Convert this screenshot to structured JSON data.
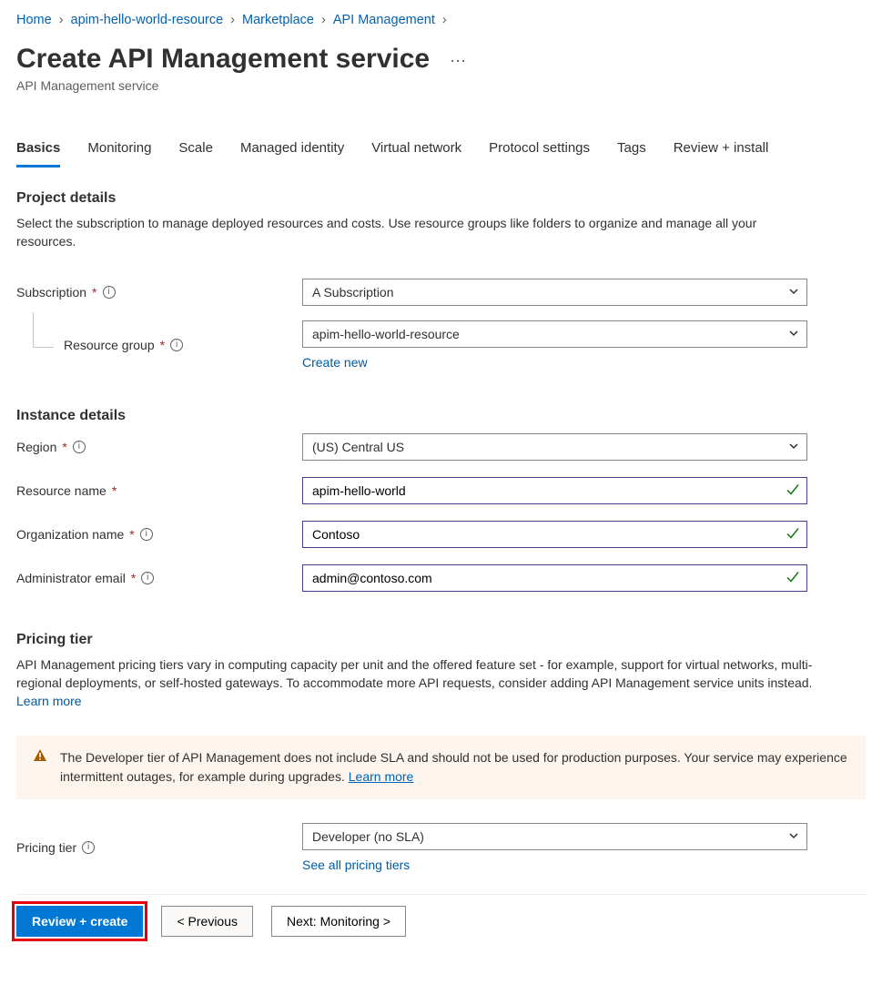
{
  "breadcrumb": {
    "items": [
      {
        "label": "Home"
      },
      {
        "label": "apim-hello-world-resource"
      },
      {
        "label": "Marketplace"
      },
      {
        "label": "API Management"
      }
    ]
  },
  "header": {
    "title": "Create API Management service",
    "subtitle": "API Management service"
  },
  "tabs": [
    {
      "label": "Basics",
      "active": true
    },
    {
      "label": "Monitoring"
    },
    {
      "label": "Scale"
    },
    {
      "label": "Managed identity"
    },
    {
      "label": "Virtual network"
    },
    {
      "label": "Protocol settings"
    },
    {
      "label": "Tags"
    },
    {
      "label": "Review + install"
    }
  ],
  "project_details": {
    "heading": "Project details",
    "desc": "Select the subscription to manage deployed resources and costs. Use resource groups like folders to organize and manage all your resources.",
    "subscription_label": "Subscription",
    "subscription_value": "A Subscription",
    "resource_group_label": "Resource group",
    "resource_group_value": "apim-hello-world-resource",
    "create_new": "Create new"
  },
  "instance_details": {
    "heading": "Instance details",
    "region_label": "Region",
    "region_value": "(US) Central US",
    "resource_name_label": "Resource name",
    "resource_name_value": "apim-hello-world",
    "org_label": "Organization name",
    "org_value": "Contoso",
    "admin_label": "Administrator email",
    "admin_value": "admin@contoso.com"
  },
  "pricing": {
    "heading": "Pricing tier",
    "desc": "API Management pricing tiers vary in computing capacity per unit and the offered feature set - for example, support for virtual networks, multi-regional deployments, or self-hosted gateways. To accommodate more API requests, consider adding API Management service units instead. ",
    "learn_more": "Learn more",
    "warning": "The Developer tier of API Management does not include SLA and should not be used for production purposes. Your service may experience intermittent outages, for example during upgrades. ",
    "warning_learn_more": "Learn more",
    "tier_label": "Pricing tier",
    "tier_value": "Developer (no SLA)",
    "see_all": "See all pricing tiers"
  },
  "footer": {
    "review_create": "Review + create",
    "previous": "< Previous",
    "next": "Next: Monitoring >"
  }
}
